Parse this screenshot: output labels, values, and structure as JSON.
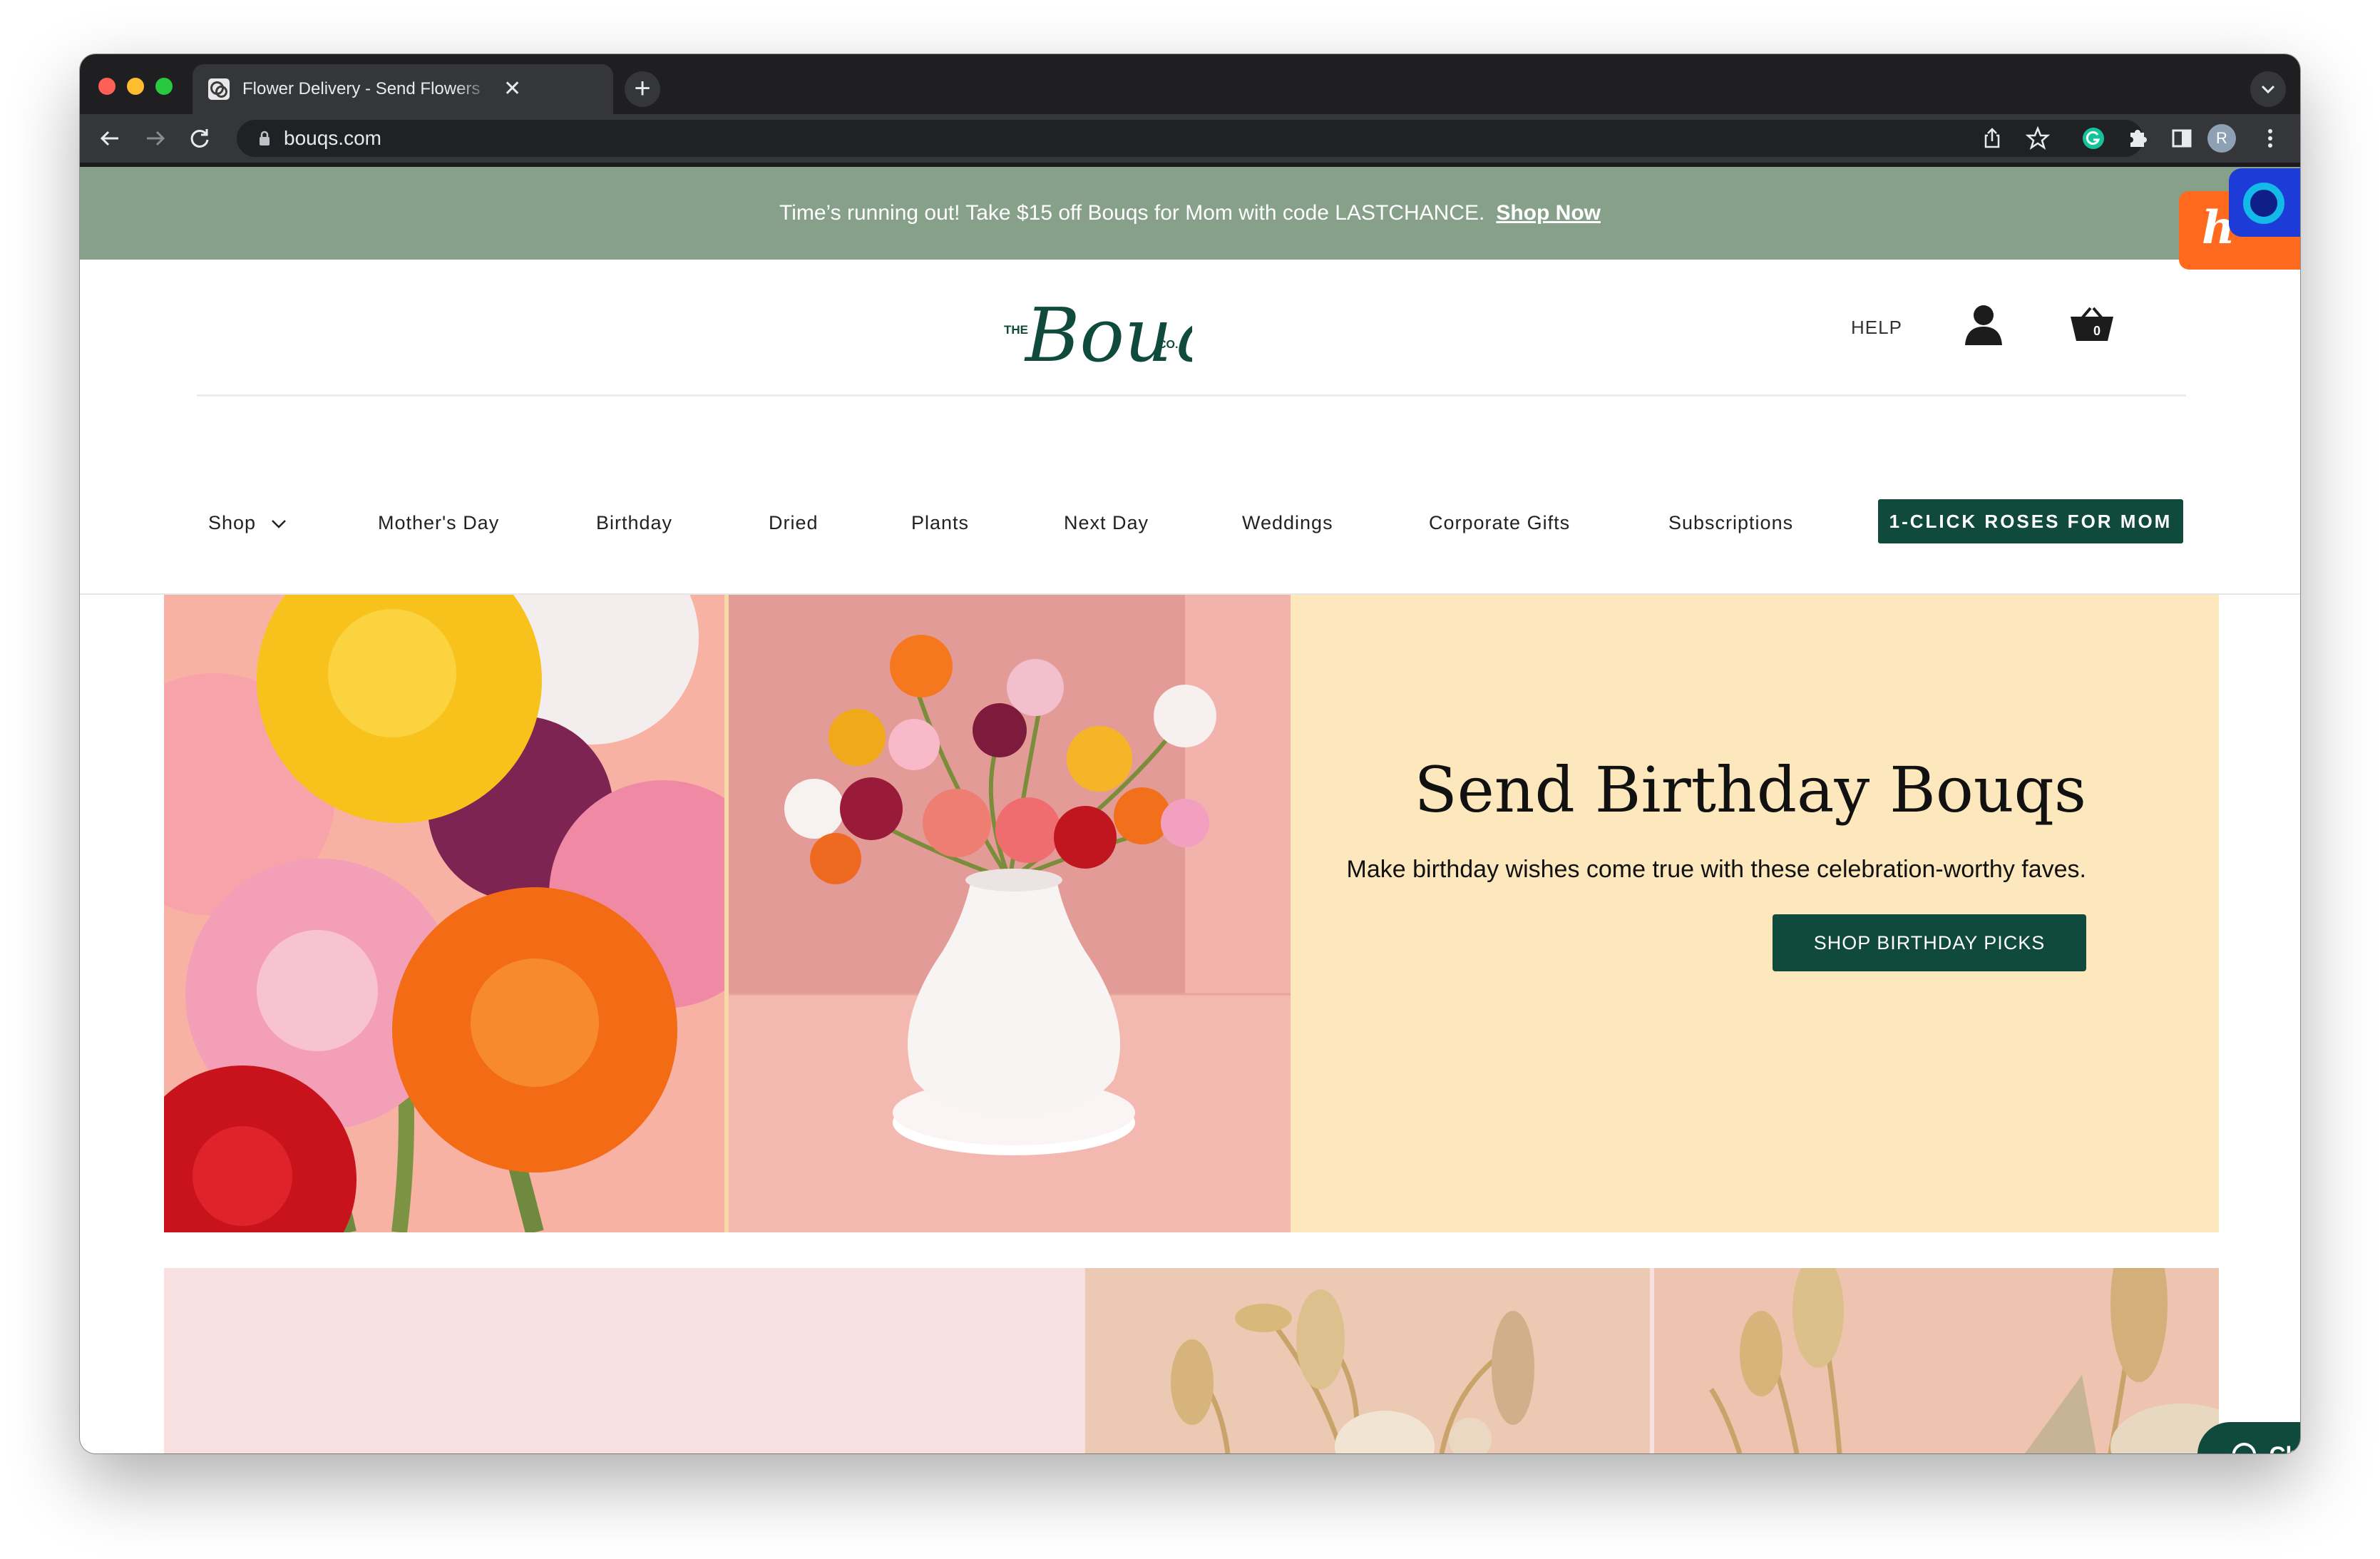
{
  "browser": {
    "tab_title": "Flower Delivery - Send Flowers",
    "tab_close": "✕",
    "new_tab": "+",
    "address": "bouqs.com",
    "profile_initial": "R"
  },
  "promo": {
    "text": "Time’s running out! Take $15 off Bouqs for Mom with code LASTCHANCE.",
    "link": "Shop Now"
  },
  "header": {
    "logo_the": "THE",
    "logo_word": "Bouqs",
    "logo_co": "CO.",
    "help": "HELP",
    "cart_count": "0"
  },
  "nav": {
    "items": [
      "Shop",
      "Mother's Day",
      "Birthday",
      "Dried",
      "Plants",
      "Next Day",
      "Weddings",
      "Corporate Gifts",
      "Subscriptions"
    ],
    "cta": "1-CLICK ROSES FOR MOM"
  },
  "hero": {
    "title": "Send Birthday Bouqs",
    "subtitle": "Make birthday wishes come true with these celebration-worthy faves.",
    "button": "SHOP BIRTHDAY PICKS"
  },
  "chat": {
    "label": "Chat"
  },
  "extensions": {
    "honey_letter": "h"
  },
  "colors": {
    "brand_green": "#0f4a3c",
    "promo_bar": "#86a08a",
    "hero_panel": "#fde8bd"
  }
}
